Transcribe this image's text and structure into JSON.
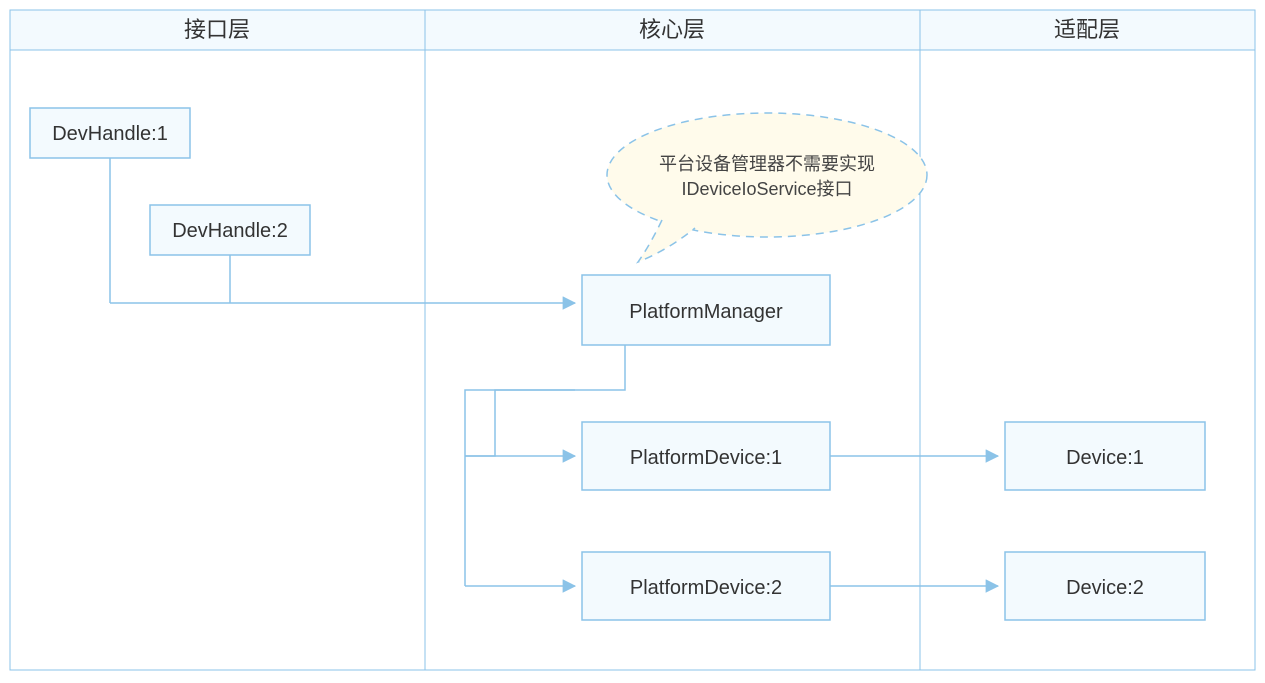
{
  "columns": {
    "interface": "接口层",
    "core": "核心层",
    "adapter": "适配层"
  },
  "nodes": {
    "devHandle1": "DevHandle:1",
    "devHandle2": "DevHandle:2",
    "platformManager": "PlatformManager",
    "platformDevice1": "PlatformDevice:1",
    "platformDevice2": "PlatformDevice:2",
    "device1": "Device:1",
    "device2": "Device:2"
  },
  "note": {
    "line1": "平台设备管理器不需要实现",
    "line2": "IDeviceIoService接口"
  }
}
